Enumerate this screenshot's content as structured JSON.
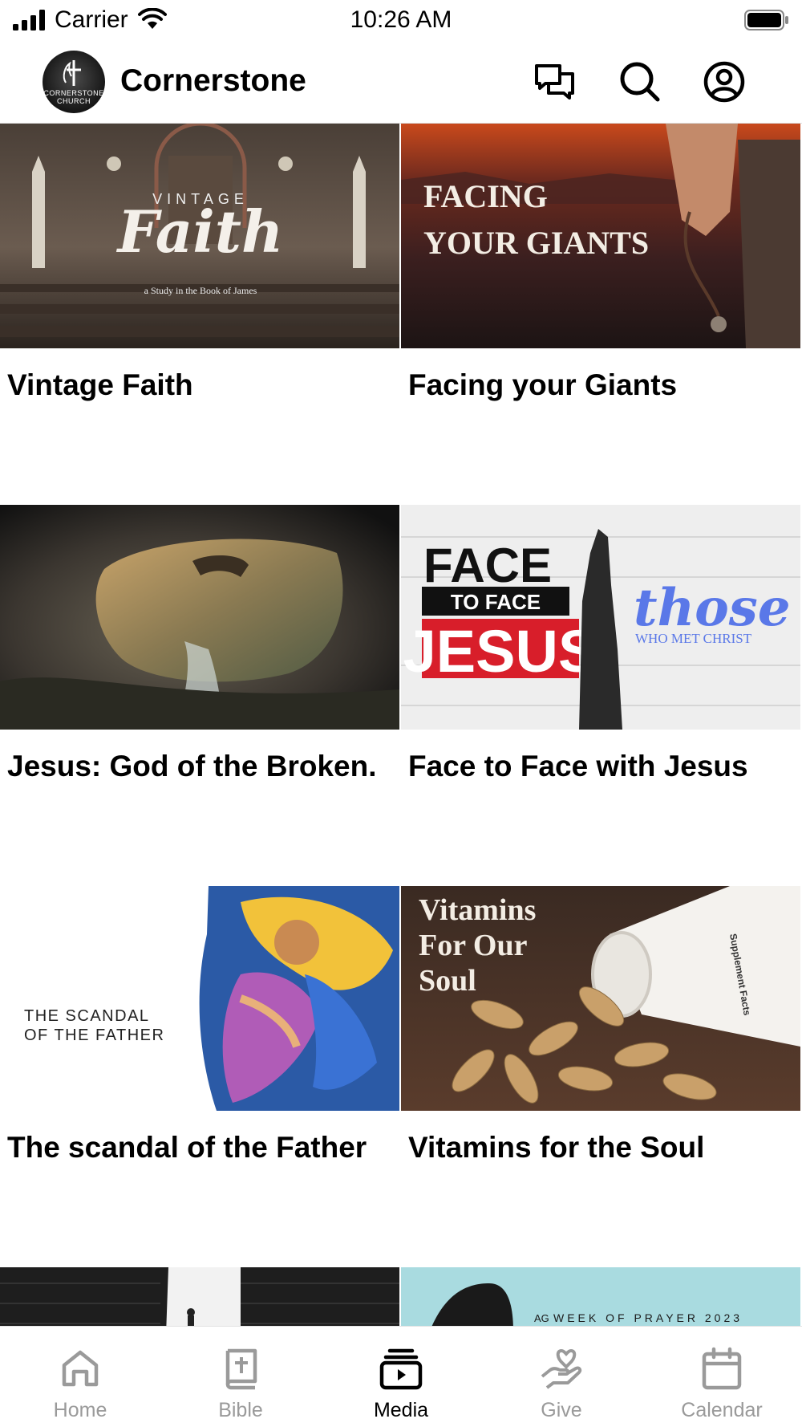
{
  "status_bar": {
    "carrier": "Carrier",
    "time": "10:26 AM"
  },
  "header": {
    "church_name": "Cornerstone",
    "logo_text": "CORNERSTONE CHURCH",
    "icons": [
      "chat-icon",
      "search-icon",
      "profile-icon"
    ]
  },
  "media": {
    "items": [
      {
        "title": "Vintage Faith",
        "thumb": {
          "kicker": "VINTAGE",
          "main": "Faith",
          "sub": "a Study in the Book of James"
        }
      },
      {
        "title": "Facing your Giants",
        "thumb": {
          "line1": "FACING",
          "line2": "YOUR GIANTS"
        }
      },
      {
        "title": "Jesus: God of the Broken.",
        "thumb": {}
      },
      {
        "title": "Face to Face with Jesus",
        "thumb": {
          "face": "FACE",
          "to_face": "TO FACE",
          "jesus": "JESUS",
          "those": "those",
          "met": "WHO MET CHRIST"
        }
      },
      {
        "title": "The scandal of the Father",
        "thumb": {
          "line1": "THE SCANDAL",
          "line2": "OF THE FATHER"
        }
      },
      {
        "title": "Vitamins for the Soul",
        "thumb": {
          "line1": "Vitamins",
          "line2": "For Our",
          "line3": "Soul",
          "label": "Supplement Facts"
        }
      },
      {
        "title": "",
        "thumb": {}
      },
      {
        "title": "",
        "thumb": {
          "banner": "WEEK OF PRAYER 2023",
          "mark": "AG"
        }
      }
    ]
  },
  "tabbar": {
    "tabs": [
      {
        "label": "Home",
        "icon": "home-icon",
        "active": false
      },
      {
        "label": "Bible",
        "icon": "bible-icon",
        "active": false
      },
      {
        "label": "Media",
        "icon": "media-icon",
        "active": true
      },
      {
        "label": "Give",
        "icon": "give-icon",
        "active": false
      },
      {
        "label": "Calendar",
        "icon": "calendar-icon",
        "active": false
      }
    ]
  },
  "colors": {
    "active_tab": "#000000",
    "inactive_tab": "#9a9a9a",
    "background": "#ffffff"
  }
}
